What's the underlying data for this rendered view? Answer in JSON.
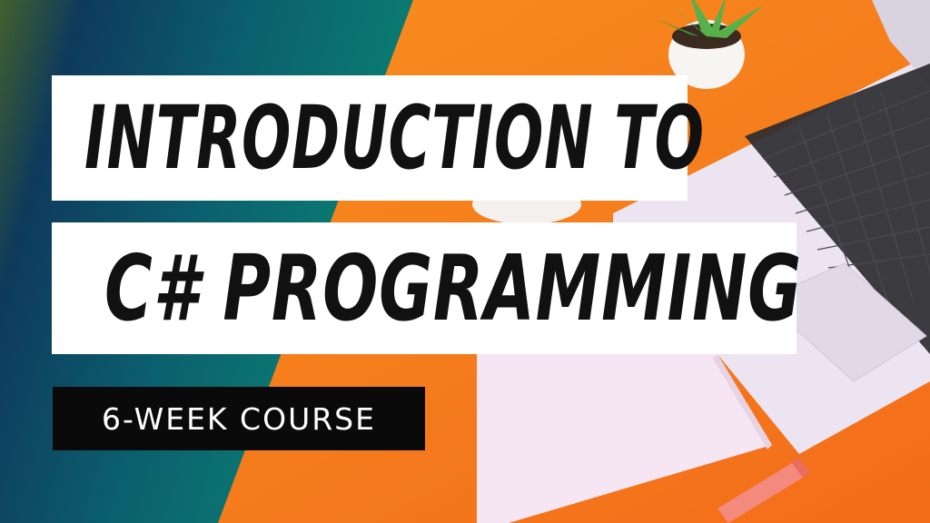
{
  "thumbnail": {
    "title_line_1": "INTRODUCTION TO",
    "title_line_2": "C# PROGRAMMING",
    "badge": "6-WEEK COURSE"
  },
  "colors": {
    "orange_background": "#f47b1c",
    "teal_panel": "#0b7b73",
    "navy_panel": "#0e3a5c",
    "title_box": "#ffffff",
    "badge_box": "#0a0a0a",
    "laptop_body": "#ece4f1",
    "keyboard_keys": "#2c2c30",
    "notebook": "#f6e6f4",
    "pen": "#f48a7e",
    "plant_pot": "#f7f5f2",
    "plant_leaves": "#58b04a"
  },
  "icons": [
    "laptop-icon",
    "plant-icon",
    "notebook-icon",
    "pen-icon",
    "mug-icon"
  ]
}
